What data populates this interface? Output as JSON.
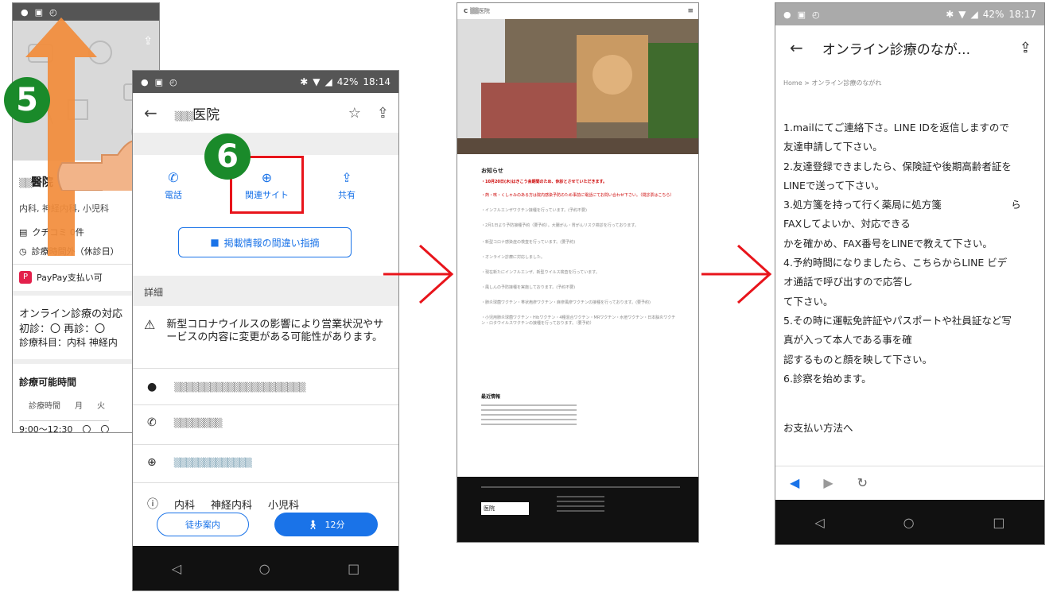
{
  "status1": {
    "time": "18:14",
    "battery": "42%"
  },
  "status2": {
    "time": "18:14",
    "battery": "42%"
  },
  "status4": {
    "time": "18:17",
    "battery": "42%"
  },
  "steps": {
    "five": "5",
    "six": "6"
  },
  "back_card": {
    "name": "醫院",
    "specialties": "内科, 神経内科, 小児科",
    "review": "クチコミ 0件",
    "hours": "診療時間外（休診日）",
    "paypay": "PayPay支払い可",
    "online_title": "オンライン診療の対応",
    "online_line1": "初診：〇 再診：〇",
    "online_line2": "診療科目：内科 神経内",
    "hours_title": "診療可能時間",
    "table_headers": [
      "診療時間",
      "月",
      "火"
    ],
    "table_row": [
      "9:00〜12:30",
      "〇",
      "〇"
    ]
  },
  "maps": {
    "title": "医院",
    "actions": [
      {
        "label": "電話",
        "icon": "phone-icon"
      },
      {
        "label": "関連サイト",
        "icon": "globe-icon"
      },
      {
        "label": "共有",
        "icon": "share-icon"
      }
    ],
    "report_button": "掲載情報の間違い指摘",
    "details_label": "詳細",
    "covid_notice": "新型コロナウイルスの影響により営業状況やサービスの内容に変更がある可能性があります。",
    "tags": [
      "内科",
      "神経内科",
      "小児科"
    ],
    "walk_button": "徒歩案内",
    "time_button": "12分"
  },
  "website": {
    "news_heading": "お知らせ",
    "news_items": [
      "・10月20日(木)はきこう会期間のため、休診とさせていただきます。",
      "・インフルエンザワクチン接種を行っています。(予約不要)",
      "・新型コロナ感染症の検査を行っています。(要予約)",
      "・オンライン診療に対応しました。",
      "・現在新たにインフルエンザ、新型ウイルス検査を行っています。",
      "・風しんの予防接種を実施しております。(予約不要)",
      "・肺炎球菌ワクチン・帯状疱疹ワクチン・麻疹風疹ワクチンの接種を行っております。(要予約)"
    ],
    "recent_heading": "最近情報",
    "footer_logo": "医院"
  },
  "online_page": {
    "title": "オンライン診療のなが...",
    "breadcrumb": "Home > オンライン診療のながれ",
    "lines": [
      "1.mailにてご連絡下さ。LINE IDを返信しますので",
      "友達申請して下さい。",
      "2.友達登録できましたら、保険証や後期高齢者証を",
      "LINEで送って下さい。",
      "3.処方箋を持って行く薬局に処方箋　　　　　　　ら",
      "FAXしてよいか、対応できる",
      "かを確かめ、FAX番号をLINEで教えて下さい。",
      "4.予約時間になりましたら、こちらからLINE ビデ",
      "オ通話で呼び出すので応答し",
      "て下さい。",
      "5.その時に運転免許証やパスポートや社員証など写",
      "真が入って本人である事を確",
      "認するものと顔を映して下さい。",
      "6.診察を始めます。"
    ],
    "payment_link": "お支払い方法へ"
  }
}
